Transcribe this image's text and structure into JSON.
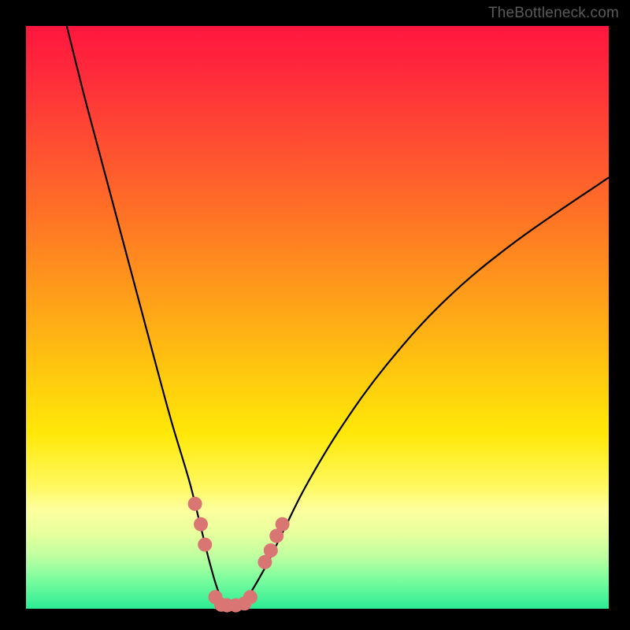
{
  "watermark": "TheBottleneck.com",
  "colors": {
    "frame": "#000000",
    "curve": "#000000",
    "marker": "#d97673"
  },
  "chart_data": {
    "type": "line",
    "title": "",
    "xlabel": "",
    "ylabel": "",
    "xlim": [
      0,
      100
    ],
    "ylim": [
      0,
      100
    ],
    "grid": false,
    "legend": false,
    "series": [
      {
        "name": "curve",
        "x": [
          7.0,
          10.0,
          14.0,
          18.0,
          22.0,
          25.0,
          28.0,
          30.0,
          31.5,
          33.0,
          34.5,
          36.0,
          38.0,
          41.0,
          44.0,
          48.0,
          54.0,
          62.0,
          72.0,
          84.0,
          100.0
        ],
        "y": [
          100.0,
          88.0,
          73.0,
          58.0,
          43.0,
          32.0,
          22.0,
          14.0,
          8.0,
          3.0,
          0.5,
          0.5,
          2.0,
          7.0,
          13.0,
          21.0,
          31.0,
          42.0,
          53.0,
          63.0,
          74.0
        ]
      }
    ],
    "markers": [
      {
        "x": 29.0,
        "y": 18.0
      },
      {
        "x": 30.0,
        "y": 14.5
      },
      {
        "x": 30.7,
        "y": 11.0
      },
      {
        "x": 32.5,
        "y": 2.0
      },
      {
        "x": 33.5,
        "y": 0.7
      },
      {
        "x": 34.5,
        "y": 0.6
      },
      {
        "x": 36.0,
        "y": 0.6
      },
      {
        "x": 37.5,
        "y": 0.9
      },
      {
        "x": 38.5,
        "y": 2.0
      },
      {
        "x": 41.0,
        "y": 8.0
      },
      {
        "x": 42.0,
        "y": 10.0
      },
      {
        "x": 43.0,
        "y": 12.5
      },
      {
        "x": 44.0,
        "y": 14.5
      }
    ],
    "gradient_stops": [
      {
        "pos": 0.0,
        "color": "#ff163e"
      },
      {
        "pos": 0.35,
        "color": "#ff7a23"
      },
      {
        "pos": 0.65,
        "color": "#ffe808"
      },
      {
        "pos": 0.85,
        "color": "#e8ff9d"
      },
      {
        "pos": 1.0,
        "color": "#2bec94"
      }
    ]
  }
}
